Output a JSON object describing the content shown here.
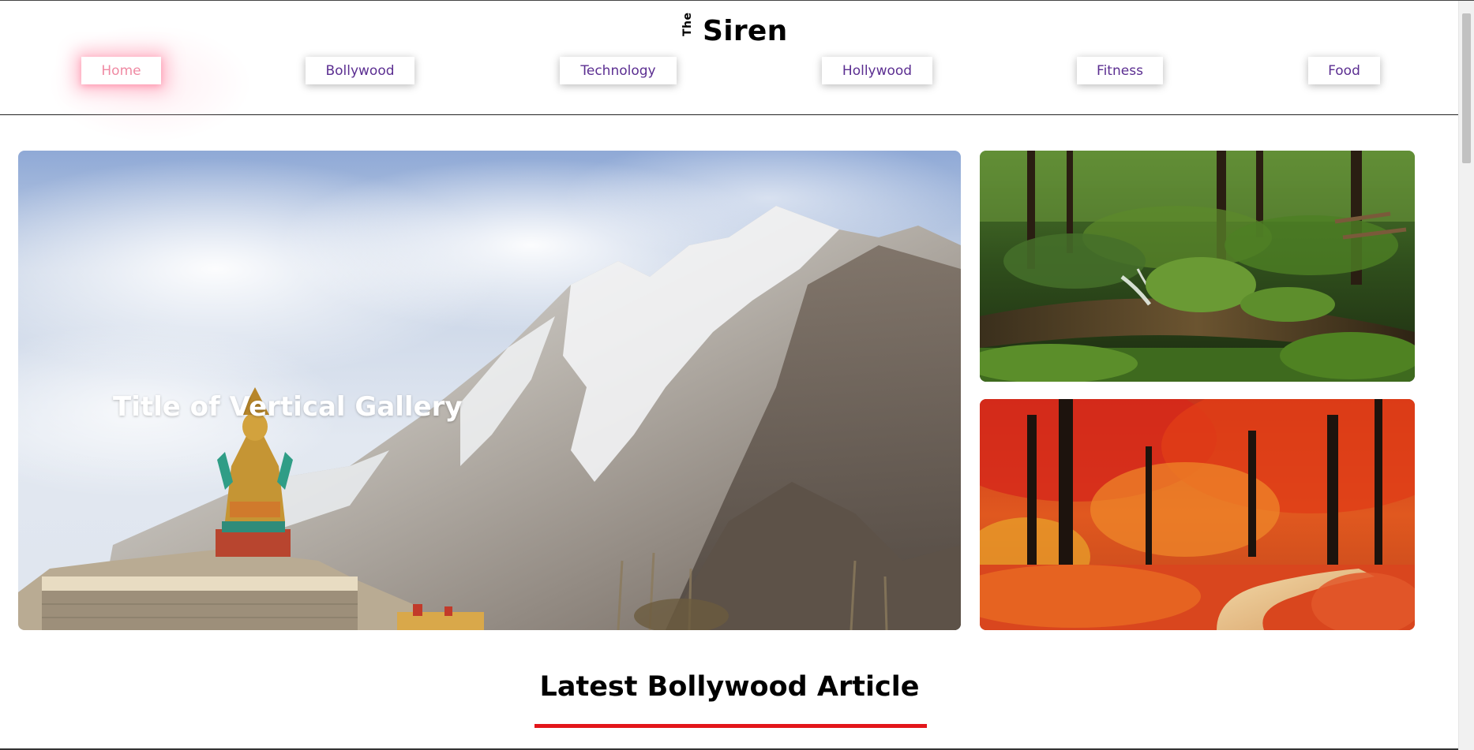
{
  "brand": {
    "prefix": "The",
    "name": "Siren"
  },
  "nav": {
    "items": [
      {
        "label": "Home",
        "active": true
      },
      {
        "label": "Bollywood",
        "active": false
      },
      {
        "label": "Technology",
        "active": false
      },
      {
        "label": "Hollywood",
        "active": false
      },
      {
        "label": "Fitness",
        "active": false
      },
      {
        "label": "Food",
        "active": false
      }
    ]
  },
  "gallery": {
    "main_title": "Title of Vertical Gallery",
    "main_image": "mountain-monastery-image",
    "side_images": [
      "forest-stream-image",
      "autumn-forest-image"
    ]
  },
  "section": {
    "heading": "Latest Bollywood Article"
  },
  "colors": {
    "nav_text": "#5b2e91",
    "nav_active_text": "#ef8aa3",
    "heading_underline": "#e3161b"
  }
}
